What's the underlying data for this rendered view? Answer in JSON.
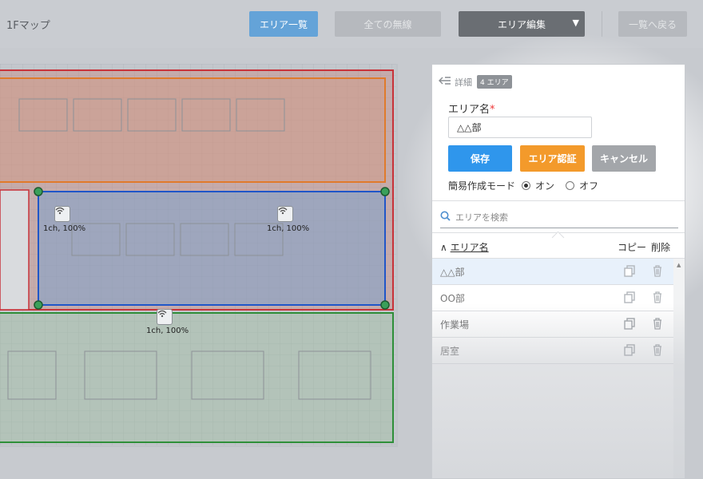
{
  "header": {
    "title": "1Fマップ",
    "area_list_label": "エリア一覧",
    "all_wireless_label": "全ての無線",
    "area_edit_label": "エリア編集",
    "area_edit_arrow": "▼",
    "back_label": "一覧へ戻る"
  },
  "map": {
    "access_points": [
      {
        "label": "1ch, 100%"
      },
      {
        "label": "1ch, 100%"
      },
      {
        "label": "1ch, 100%"
      }
    ],
    "area_colors": {
      "red": "#c8333a",
      "orange": "#e07a2b",
      "blue": "#2056c8",
      "green": "#2f8f3a"
    }
  },
  "panel": {
    "back_icon": "arrow-left-lines-icon",
    "detail_label": "詳細",
    "area_count_badge": "4 エリア",
    "area_name_label": "エリア名",
    "required_mark": "*",
    "area_name_value": "△△部",
    "save_label": "保存",
    "auth_label": "エリア認証",
    "cancel_label": "キャンセル",
    "mode_label": "簡易作成モード",
    "mode_on_label": "オン",
    "mode_off_label": "オフ",
    "search_placeholder": "エリアを検索",
    "sort_arrow": "∧",
    "col_name_label": "エリア名",
    "col_copy_label": "コピー",
    "col_delete_label": "削除",
    "areas": [
      {
        "name": "△△部"
      },
      {
        "name": "OO部"
      },
      {
        "name": "作業場"
      },
      {
        "name": "居室"
      }
    ],
    "accent": "#2f96ec",
    "warn": "#f39a2b"
  }
}
